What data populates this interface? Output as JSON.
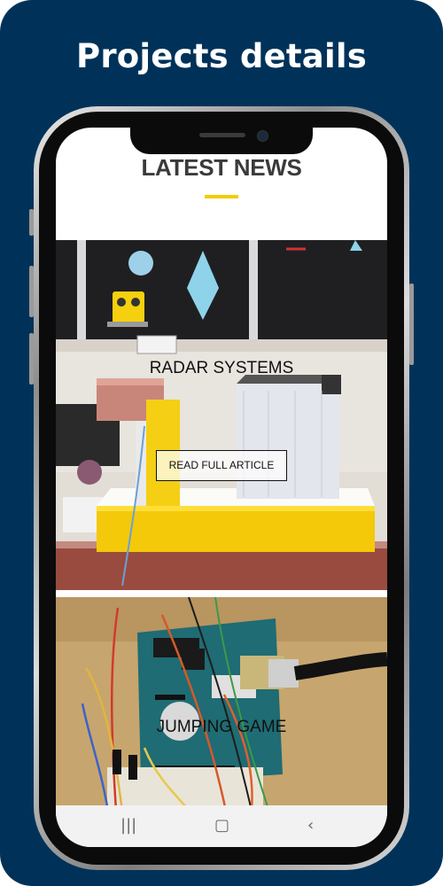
{
  "promo": {
    "title": "Projects details"
  },
  "app": {
    "heading": "LATEST NEWS",
    "accent_color": "#f2cd00",
    "articles": [
      {
        "title": "RADAR SYSTEMS",
        "button_label": "READ FULL ARTICLE",
        "image": "radar-project-photo"
      },
      {
        "title": "JUMPING GAME",
        "image": "arduino-breadboard-photo"
      }
    ]
  },
  "navbar": {
    "recents_icon": "recents-icon",
    "home_icon": "home-icon",
    "back_icon": "back-icon"
  }
}
